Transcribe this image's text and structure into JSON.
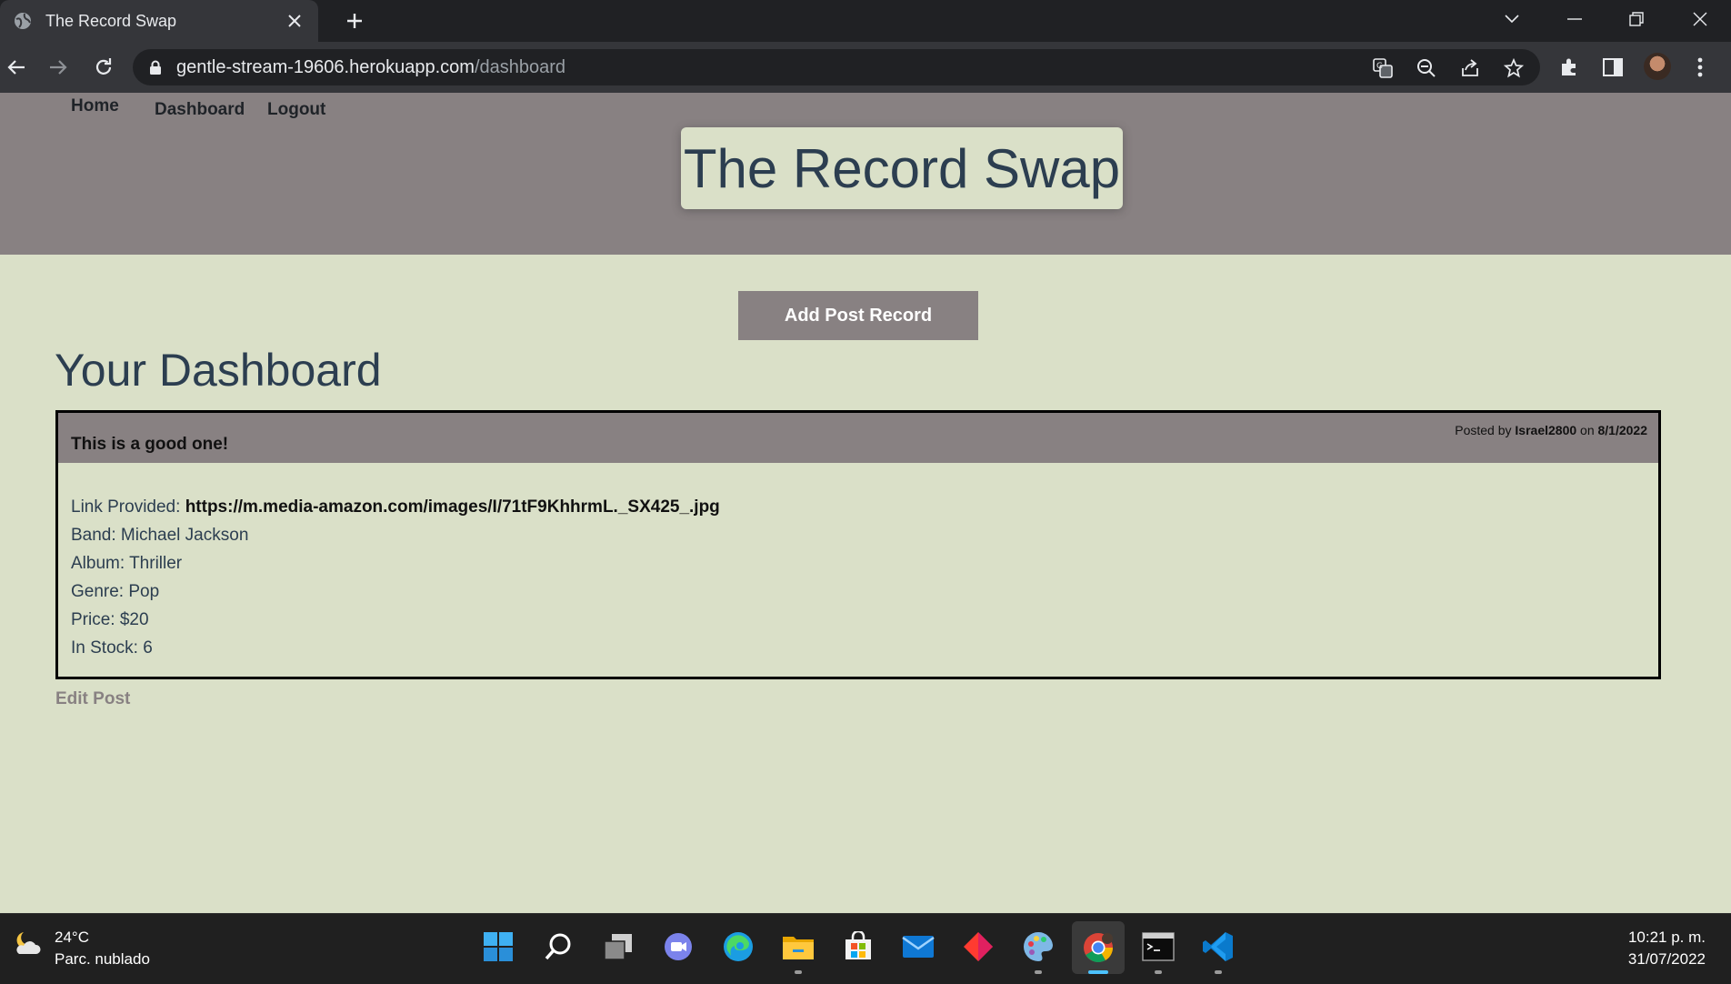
{
  "browser": {
    "tab_title": "The Record Swap",
    "url_host": "gentle-stream-19606.herokuapp.com",
    "url_path": "/dashboard"
  },
  "nav": {
    "home": "Home",
    "dashboard": "Dashboard",
    "logout": "Logout"
  },
  "site": {
    "title": "The Record Swap"
  },
  "main": {
    "add_button": "Add Post Record",
    "dashboard_title": "Your Dashboard",
    "edit_link": "Edit Post"
  },
  "post": {
    "title": "This is a good one!",
    "meta_prefix": "Posted by",
    "author": "Israel2800",
    "meta_on": "on",
    "date": "8/1/2022",
    "link_label": "Link Provided:",
    "link_value": "https://m.media-amazon.com/images/I/71tF9KhhrmL._SX425_.jpg",
    "band": "Band: Michael Jackson",
    "album": "Album: Thriller",
    "genre": "Genre: Pop",
    "price": "Price: $20",
    "stock": "In Stock: 6"
  },
  "taskbar": {
    "temperature": "24°C",
    "weather": "Parc. nublado",
    "time": "10:21 p. m.",
    "date": "31/07/2022"
  },
  "colors": {
    "header_bg": "#888182",
    "page_bg": "#dae0c8",
    "title_text": "#2c3e50"
  }
}
